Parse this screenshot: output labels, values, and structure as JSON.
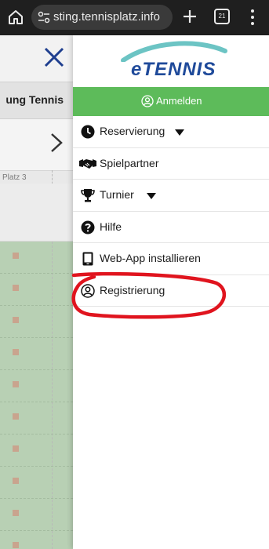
{
  "browser": {
    "url": "sting.tennisplatz.info",
    "tab_count": "21",
    "icons": {
      "home": "home-icon",
      "site_settings": "site-settings-icon",
      "new_tab": "plus-icon",
      "tabs": "tab-switcher-icon",
      "menu": "more-vert-icon"
    }
  },
  "background_page": {
    "title": "ung Tennis",
    "column_label": "Platz 3",
    "icons": {
      "close": "close-icon",
      "next": "chevron-right-icon"
    }
  },
  "drawer": {
    "logo_text": "eTENNIS",
    "login_label": "Anmelden",
    "items": [
      {
        "label": "Reservierung",
        "icon": "clock-icon",
        "has_dropdown": true
      },
      {
        "label": "Spielpartner",
        "icon": "handshake-icon",
        "has_dropdown": false
      },
      {
        "label": "Turnier",
        "icon": "trophy-icon",
        "has_dropdown": true
      },
      {
        "label": "Hilfe",
        "icon": "help-icon",
        "has_dropdown": false
      },
      {
        "label": "Web-App installieren",
        "icon": "tablet-icon",
        "has_dropdown": false
      },
      {
        "label": "Registrierung",
        "icon": "user-circle-icon",
        "has_dropdown": false
      }
    ]
  },
  "colors": {
    "browser_bar": "#1f1f1f",
    "brand_blue": "#1f4a9a",
    "login_green": "#5dbb5a",
    "court_green": "#b8d0b4",
    "annotation_red": "#e0141e"
  }
}
